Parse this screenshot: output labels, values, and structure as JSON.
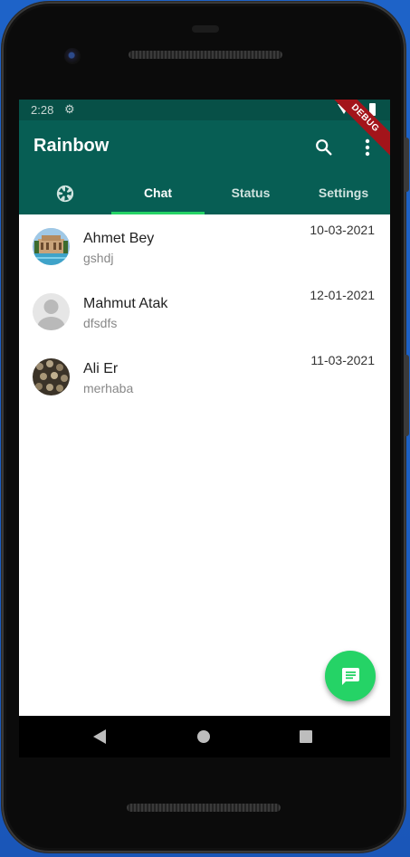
{
  "status_bar": {
    "time": "2:28"
  },
  "app_bar": {
    "title": "Rainbow",
    "debug_banner": "DEBUG"
  },
  "tabs": [
    {
      "label": "",
      "icon": "camera-icon"
    },
    {
      "label": "Chat"
    },
    {
      "label": "Status"
    },
    {
      "label": "Settings"
    }
  ],
  "active_tab": "Chat",
  "chats": [
    {
      "name": "Ahmet Bey",
      "message": "gshdj",
      "date": "10-03-2021",
      "avatar": "photo-building"
    },
    {
      "name": "Mahmut Atak",
      "message": "dfsdfs",
      "date": "12-01-2021",
      "avatar": "default-person"
    },
    {
      "name": "Ali Er",
      "message": "merhaba",
      "date": "11-03-2021",
      "avatar": "photo-texture"
    }
  ],
  "fab": {
    "icon": "message-icon"
  },
  "colors": {
    "primary": "#075e54",
    "status_bar": "#075047",
    "accent": "#25d366"
  }
}
